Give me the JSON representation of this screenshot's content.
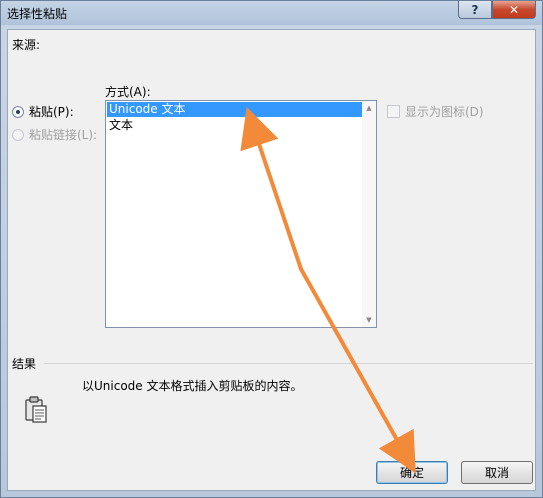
{
  "window": {
    "title": "选择性粘贴",
    "help_label": "?",
    "close_label": "✕"
  },
  "source": {
    "label": "来源:"
  },
  "method": {
    "label": "方式(A):",
    "items": [
      "Unicode 文本",
      "文本"
    ],
    "selected_index": 0
  },
  "options": {
    "paste": {
      "label": "粘贴(P):",
      "checked": true,
      "disabled": false
    },
    "paste_link": {
      "label": "粘贴链接(L):",
      "checked": false,
      "disabled": true
    },
    "show_as_icon": {
      "label": "显示为图标(D)",
      "checked": false,
      "disabled": true
    }
  },
  "result": {
    "label": "结果",
    "text": "以Unicode 文本格式插入剪贴板的内容。"
  },
  "buttons": {
    "ok": "确定",
    "cancel": "取消"
  },
  "colors": {
    "selection": "#3399ff",
    "annotation_arrow": "#f28a3a",
    "close_button": "#c7482c"
  },
  "icons": {
    "result": "clipboard-icon",
    "scroll_up": "scroll-up-arrow-icon",
    "scroll_down": "scroll-down-arrow-icon"
  }
}
